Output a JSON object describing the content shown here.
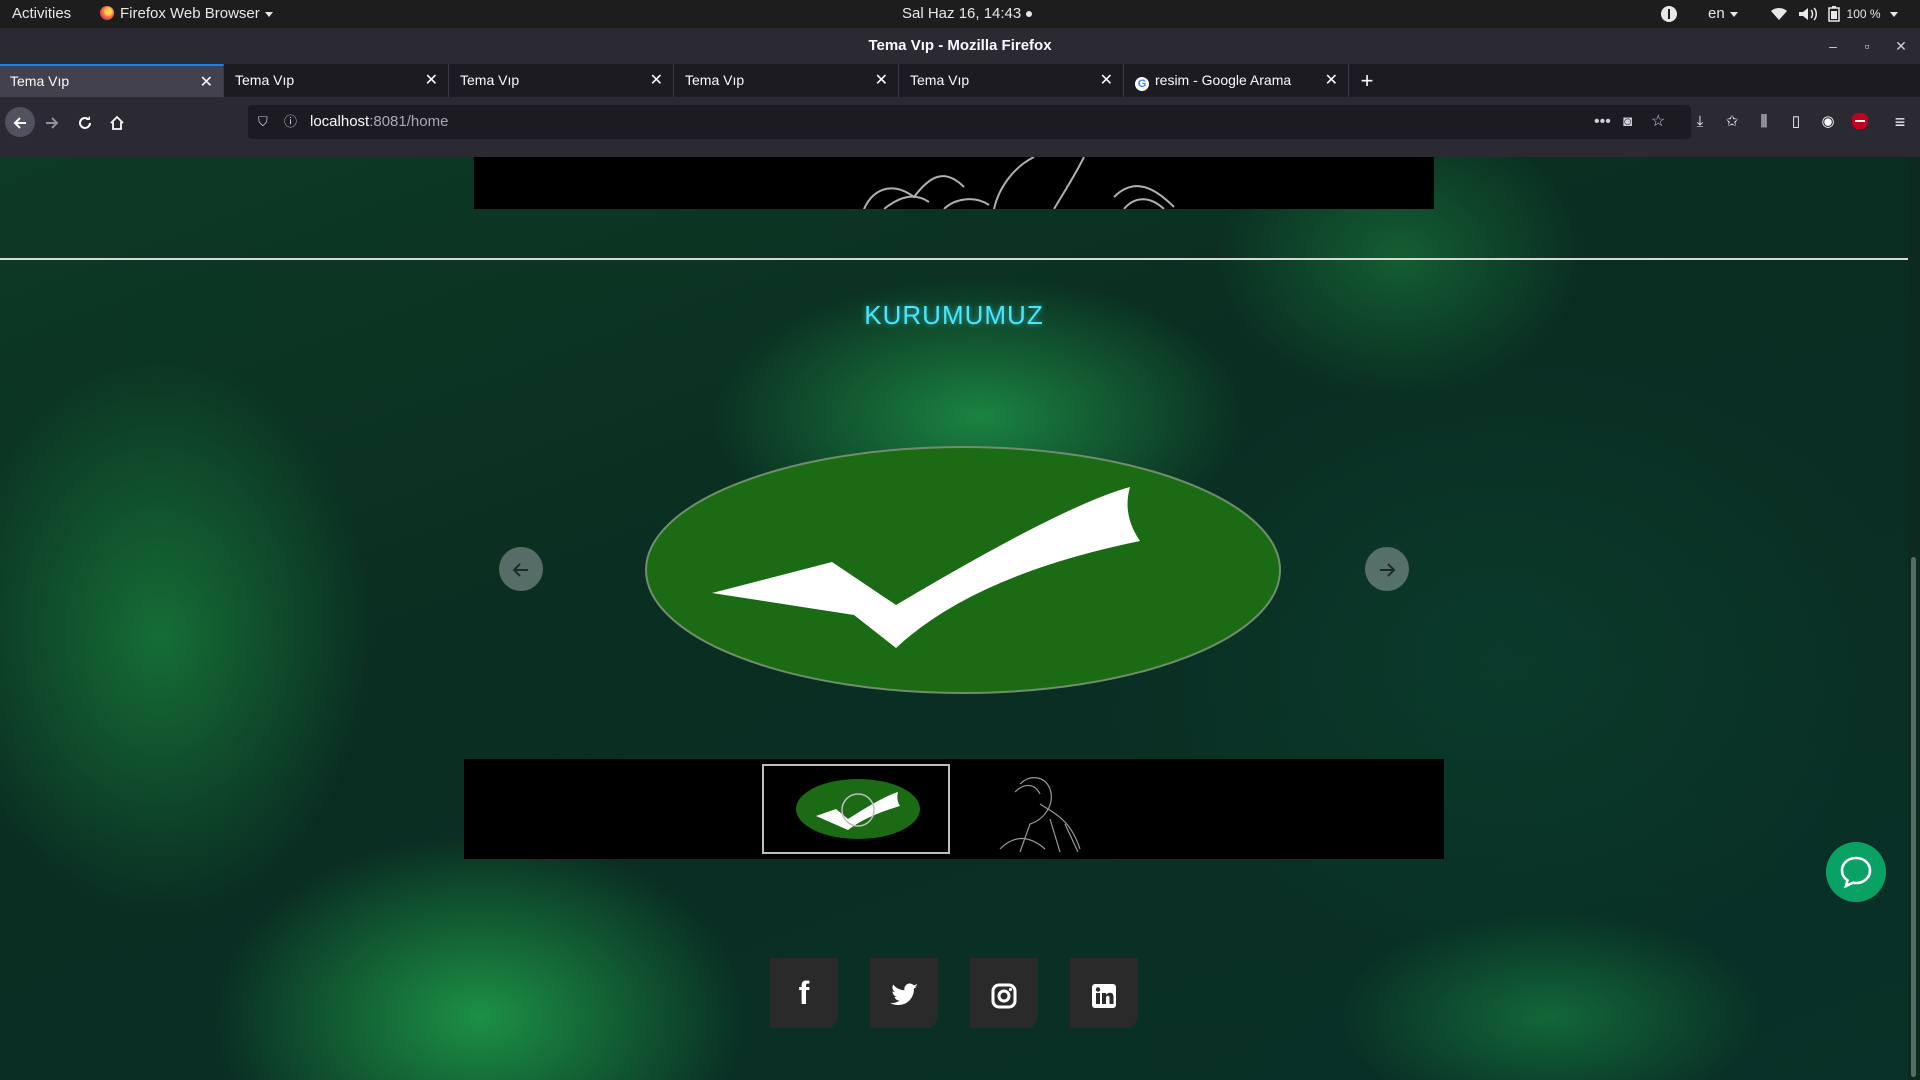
{
  "topbar": {
    "activities": "Activities",
    "app_menu": "Firefox Web Browser",
    "clock": "Sal Haz 16, 14:43",
    "lang": "en",
    "battery": "100 %"
  },
  "window": {
    "title": "Tema Vıp - Mozilla Firefox"
  },
  "tabs": [
    {
      "label": "Tema Vıp",
      "active": true
    },
    {
      "label": "Tema Vıp",
      "active": false
    },
    {
      "label": "Tema Vıp",
      "active": false
    },
    {
      "label": "Tema Vıp",
      "active": false
    },
    {
      "label": "Tema Vıp",
      "active": false
    },
    {
      "label": "resim - Google Arama",
      "active": false,
      "favicon": "google"
    }
  ],
  "tab_close_glyph": "✕",
  "navbar": {
    "url_host": "localhost",
    "url_rest": ":8081/home"
  },
  "page": {
    "section_title": "KURUMUMUZ",
    "social": [
      {
        "name": "facebook",
        "glyph": "f"
      },
      {
        "name": "twitter",
        "glyph": "🐦"
      },
      {
        "name": "instagram",
        "glyph": "◻"
      },
      {
        "name": "linkedin",
        "glyph": "in"
      }
    ]
  },
  "colors": {
    "accent_title": "#48e6ff",
    "checkmark_green": "#1b6a14",
    "chat_green": "#0aa164",
    "tab_active_line": "#0a84ff"
  }
}
